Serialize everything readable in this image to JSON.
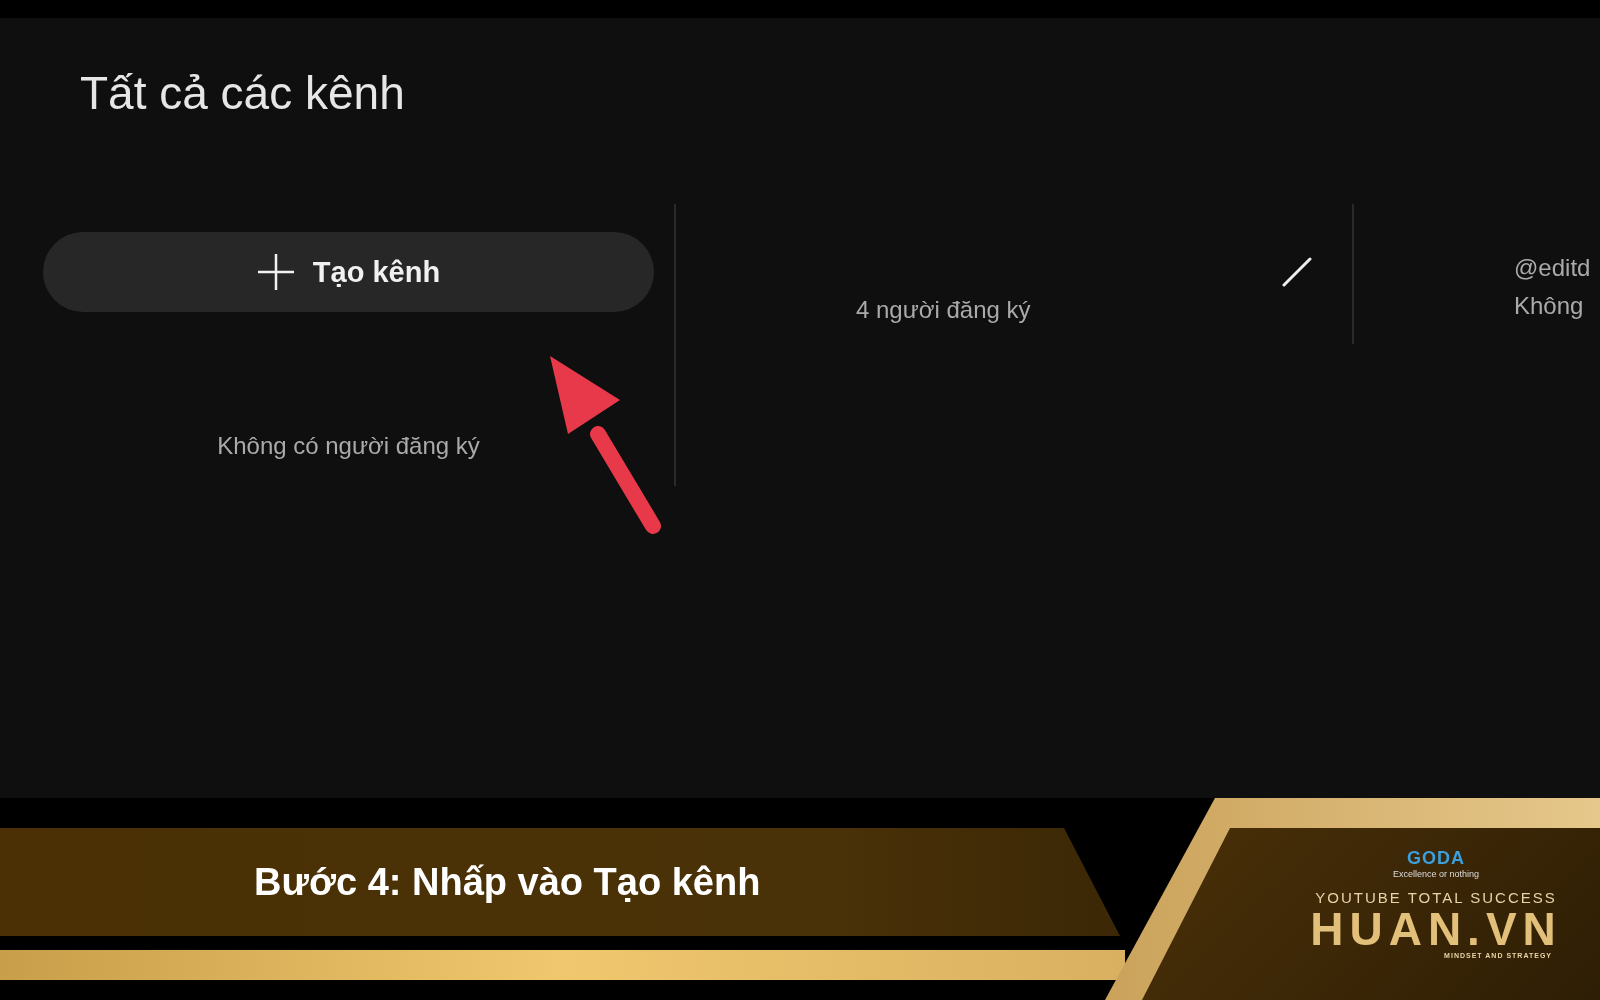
{
  "page_title": "Tất cả các kênh",
  "create_button": {
    "label": "Tạo kênh"
  },
  "channels": [
    {
      "subscribers": "Không có người đăng ký"
    },
    {
      "subscribers": "4 người đăng ký",
      "editable": true
    },
    {
      "handle": "@editd",
      "subscribers": "Không"
    }
  ],
  "caption": "Bước 4: Nhấp vào Tạo kênh",
  "logo": {
    "brand": "GODA",
    "slogan": "Excellence or nothing",
    "tagline": "YOUTUBE TOTAL SUCCESS",
    "name": "HUAN.VN",
    "subtitle": "MINDSET AND STRATEGY"
  }
}
